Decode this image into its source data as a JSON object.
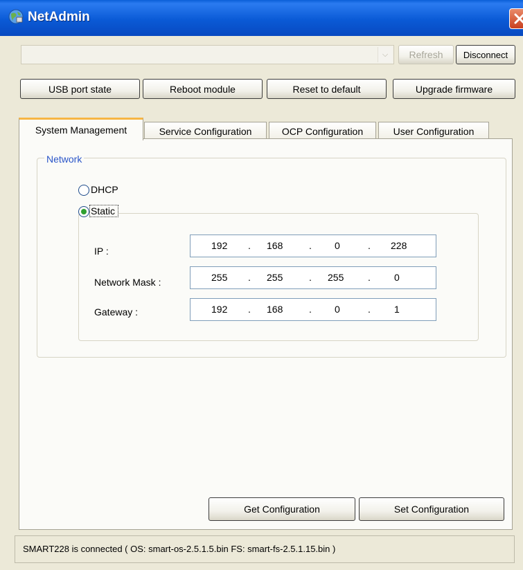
{
  "window": {
    "title": "NetAdmin"
  },
  "toolbar": {
    "refresh_label": "Refresh",
    "disconnect_label": "Disconnect",
    "usb_label": "USB port state",
    "reboot_label": "Reboot module",
    "reset_label": "Reset to default",
    "upgrade_label": "Upgrade firmware"
  },
  "tabs": [
    {
      "label": "System Management",
      "active": true
    },
    {
      "label": "Service Configuration"
    },
    {
      "label": "OCP Configuration"
    },
    {
      "label": "User Configuration"
    }
  ],
  "network": {
    "legend": "Network",
    "dhcp_label": "DHCP",
    "static_label": "Static",
    "selected": "Static",
    "ip_label": "IP :",
    "ip": [
      "192",
      "168",
      "0",
      "228"
    ],
    "mask_label": "Network Mask :",
    "mask": [
      "255",
      "255",
      "255",
      "0"
    ],
    "gateway_label": "Gateway :",
    "gateway": [
      "192",
      "168",
      "0",
      "1"
    ],
    "dot": "."
  },
  "actions": {
    "get_label": "Get Configuration",
    "set_label": "Set Configuration"
  },
  "status": {
    "text": "SMART228 is connected ( OS: smart-os-2.5.1.5.bin  FS: smart-fs-2.5.1.15.bin )"
  },
  "colors": {
    "titlebar": "#0a5ad6",
    "window_bg": "#ece9d8",
    "legend_text": "#2a55c8",
    "active_tab_accent": "#f7b544",
    "radio_selected": "#2fa02f",
    "close_button": "#c9401f"
  },
  "icons": {
    "app": "netadmin-globe-icon",
    "close": "close-icon",
    "combo_arrow": "chevron-down-icon"
  }
}
